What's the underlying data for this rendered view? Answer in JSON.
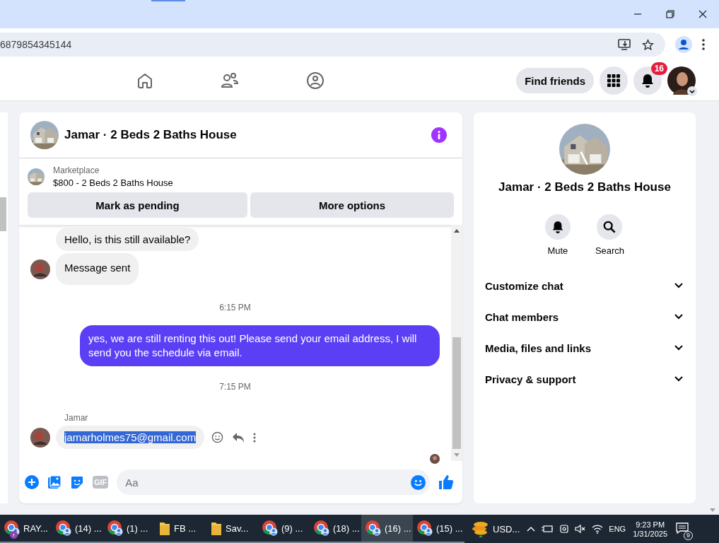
{
  "browser": {
    "url": "6879854345144"
  },
  "nav": {
    "find_friends": "Find friends",
    "notification_count": "16"
  },
  "chat": {
    "title": "Jamar · 2 Beds 2 Baths House",
    "listing": {
      "source": "Marketplace",
      "title": "$800 - 2 Beds 2 Baths House"
    },
    "actions": [
      "Mark as pending",
      "More options"
    ],
    "messages": [
      {
        "kind": "incoming",
        "text": "Hello, is this still available?",
        "avatar": false,
        "selected": false,
        "hovered": false
      },
      {
        "kind": "incoming",
        "text": "Message sent",
        "avatar": true,
        "selected": false,
        "hovered": false
      },
      {
        "kind": "time",
        "text": "6:15 PM"
      },
      {
        "kind": "outgoing",
        "text": "yes, we are still renting this out! Please send your email address, I will send you the schedule via email."
      },
      {
        "kind": "time",
        "text": "7:15 PM"
      },
      {
        "kind": "sender",
        "text": "Jamar"
      },
      {
        "kind": "incoming",
        "text": "jamarholmes75@gmail.com",
        "avatar": true,
        "selected": true,
        "hovered": true
      }
    ],
    "composer": {
      "gif": "GIF",
      "placeholder": "Aa"
    }
  },
  "details": {
    "title": "Jamar · 2 Beds 2 Baths House",
    "actions": [
      {
        "kind": "mute",
        "label": "Mute"
      },
      {
        "kind": "search",
        "label": "Search"
      }
    ],
    "sections": [
      "Customize chat",
      "Chat members",
      "Media, files and links",
      "Privacy & support"
    ]
  },
  "taskbar": {
    "items": [
      {
        "kind": "chrome",
        "label": "RAY...",
        "badge": "r",
        "selected": false
      },
      {
        "kind": "chrome",
        "label": "(14) ...",
        "selected": false
      },
      {
        "kind": "chrome",
        "label": "(1) ...",
        "selected": false
      },
      {
        "kind": "folder",
        "label": "FB ...",
        "selected": false
      },
      {
        "kind": "folder",
        "label": "Sav...",
        "selected": false
      },
      {
        "kind": "chrome",
        "label": "(9) ...",
        "selected": false
      },
      {
        "kind": "chrome",
        "label": "(18) ...",
        "selected": false
      },
      {
        "kind": "chrome",
        "label": "(16) ...",
        "selected": true
      },
      {
        "kind": "chrome",
        "label": "(15) ...",
        "selected": false
      }
    ],
    "currency": "USD...",
    "language": "ENG",
    "time": "9:23 PM",
    "date": "1/31/2025",
    "notifications": "9"
  }
}
